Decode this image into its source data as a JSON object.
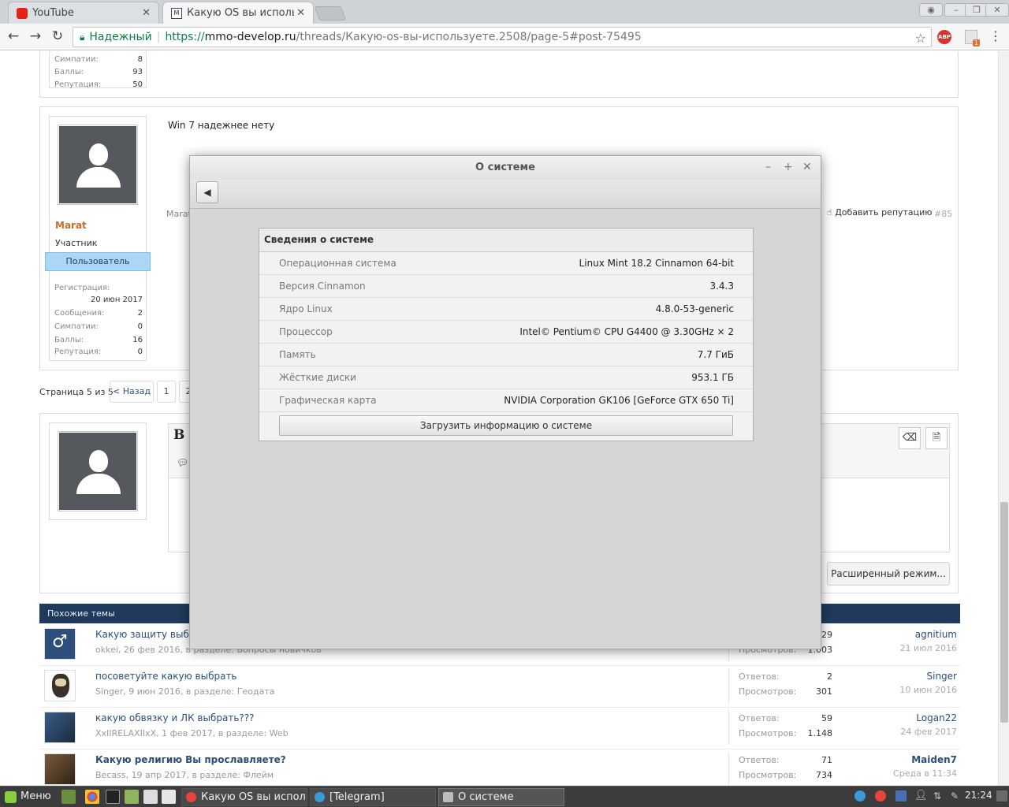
{
  "browser": {
    "tabs": [
      {
        "label": "YouTube",
        "active": false
      },
      {
        "label": "Какую OS вы использу",
        "active": true
      }
    ],
    "address": {
      "secure_label": "Надежный",
      "protocol": "https://",
      "host": "mmo-develop.ru",
      "path": "/threads/Какую-os-вы-используете.2508/page-5#post-75495"
    },
    "ext_abp": "ABP",
    "ext_badge": "1"
  },
  "prev_post": {
    "stats": [
      {
        "label": "Симпатии:",
        "value": "8"
      },
      {
        "label": "Баллы:",
        "value": "93"
      },
      {
        "label": "Репутация:",
        "value": "50"
      }
    ]
  },
  "post": {
    "text": "Win 7 надежнее нету",
    "username": "Marat",
    "user_title": "Участник",
    "banner": "Пользователь",
    "reg_label": "Регистрация:",
    "reg_date": "20 июн 2017",
    "stats": [
      {
        "label": "Сообщения:",
        "value": "2"
      },
      {
        "label": "Симпатии:",
        "value": "0"
      },
      {
        "label": "Баллы:",
        "value": "16"
      },
      {
        "label": "Репутация:",
        "value": "0"
      }
    ],
    "author_short": "Marat",
    "add_rep": "Добавить репутацию",
    "post_no": "#85"
  },
  "pagination": {
    "label": "Страница 5 из 5",
    "back": "< Назад",
    "pages": [
      "1",
      "2"
    ]
  },
  "reply": {
    "bold": "B",
    "advanced": "Расширенный режим..."
  },
  "dialog": {
    "title": "О системе",
    "heading": "Сведения о системе",
    "rows": [
      {
        "k": "Операционная система",
        "v": "Linux Mint 18.2 Cinnamon 64-bit"
      },
      {
        "k": "Версия Cinnamon",
        "v": "3.4.3"
      },
      {
        "k": "Ядро Linux",
        "v": "4.8.0-53-generic"
      },
      {
        "k": "Процессор",
        "v": "Intel© Pentium© CPU G4400 @ 3.30GHz × 2"
      },
      {
        "k": "Память",
        "v": "7.7 ГиБ"
      },
      {
        "k": "Жёсткие диски",
        "v": "953.1 ГБ"
      },
      {
        "k": "Графическая карта",
        "v": "NVIDIA Corporation GK106 [GeForce GTX 650 Ti]"
      }
    ],
    "upload": "Загрузить информацию о системе"
  },
  "similar": {
    "heading": "Похожие темы",
    "replies_label": "Ответов:",
    "views_label": "Просмотров:",
    "rows": [
      {
        "title": "Какую защиту выбрать",
        "meta": "okkei, 26 фев 2016, в разделе: Вопросы новичков",
        "replies": "29",
        "views": "1.003",
        "last_user": "agnitium",
        "last_date": "21 июл 2016",
        "icon": "male-symbol-icon"
      },
      {
        "title": "посоветуйте какую выбрать",
        "meta": "Singer, 9 июн 2016, в разделе: Геодата",
        "replies": "2",
        "views": "301",
        "last_user": "Singer",
        "last_date": "10 июн 2016",
        "icon": "cartoon-avatar-icon"
      },
      {
        "title": "какую обвязку и ЛК выбрать???",
        "meta": "XxIIRELAXIIxX, 1 фев 2017, в разделе: Web",
        "replies": "59",
        "views": "1.148",
        "last_user": "Logan22",
        "last_date": "24 фев 2017",
        "icon": "warrior-avatar-icon"
      },
      {
        "title": "Какую религию Вы прославляете?",
        "meta": "Becass, 19 апр 2017, в разделе: Флейм",
        "replies": "71",
        "views": "734",
        "last_user": "Maiden7",
        "last_date": "Среда в 11:34",
        "icon": "warrior-avatar-icon"
      }
    ]
  },
  "taskbar": {
    "menu": "Меню",
    "windows": [
      {
        "label": "Какую OS вы испол...",
        "active": false
      },
      {
        "label": "[Telegram]",
        "active": false
      },
      {
        "label": "О системе",
        "active": true
      }
    ],
    "clock": "21:24"
  }
}
